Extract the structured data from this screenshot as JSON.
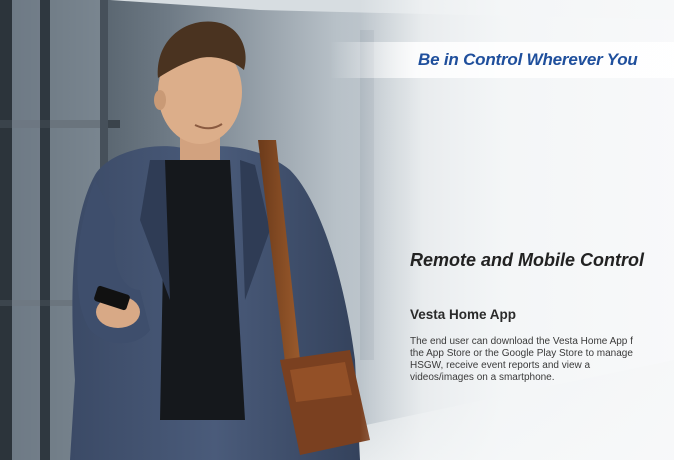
{
  "banner": {
    "tagline": "Be in Control Wherever You"
  },
  "section": {
    "title": "Remote and Mobile Control"
  },
  "app": {
    "title": "Vesta Home App",
    "description_lines": [
      "The end user can download the Vesta Home App f",
      "the App Store or the Google Play Store to manage",
      "HSGW,   receive   event   reports   and   view   a",
      "videos/images on a smartphone."
    ]
  },
  "photo": {
    "subject": "man-with-smartphone-photo"
  }
}
